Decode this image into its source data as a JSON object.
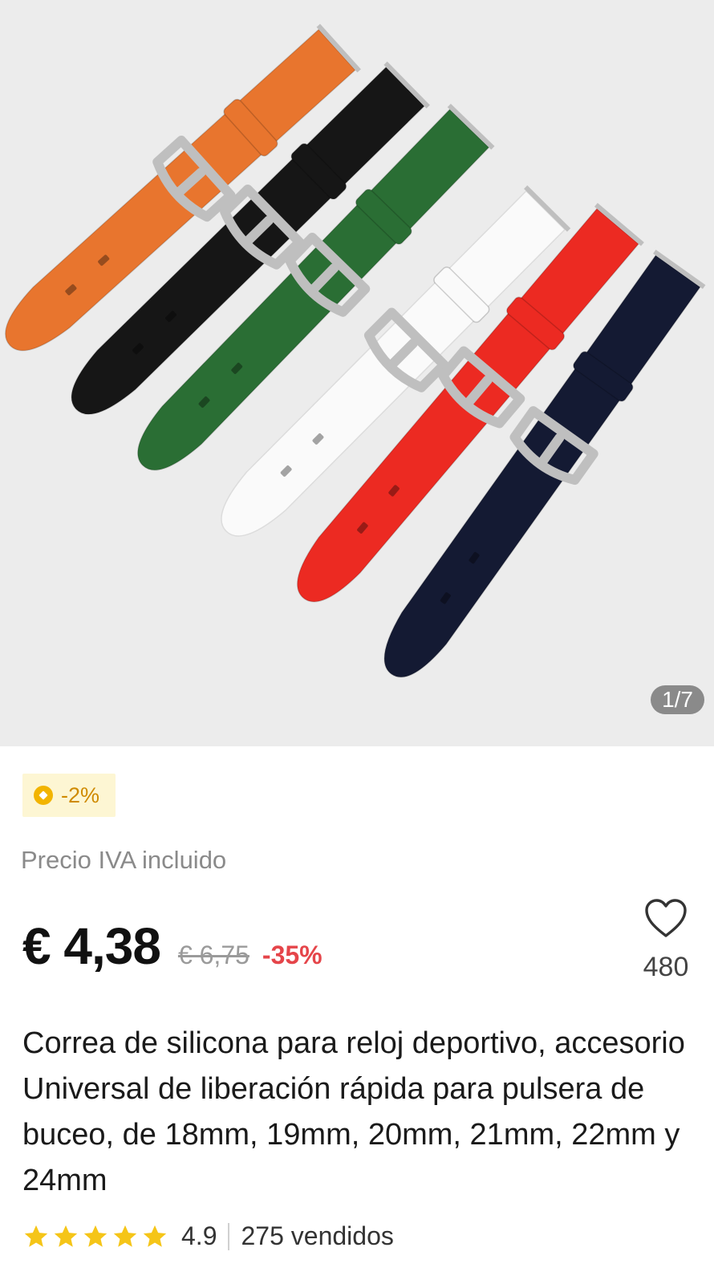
{
  "gallery": {
    "counter": "1/7",
    "strap_colors": [
      "#e8752e",
      "#161616",
      "#2a6e34",
      "#fafafa",
      "#ec2a22",
      "#141a33"
    ],
    "buckle_color": "#bfbfbf",
    "background": "#ececec"
  },
  "promo": {
    "icon": "coin-icon",
    "label": "-2%"
  },
  "price": {
    "vat_note": "Precio IVA incluido",
    "current": "€ 4,38",
    "original": "€ 6,75",
    "discount": "-35%",
    "discount_color": "#e5454a"
  },
  "wishlist": {
    "icon": "heart-icon",
    "count": "480"
  },
  "product": {
    "title": "Correa de silicona para reloj deportivo, accesorio Universal de liberación rápida para pulsera de buceo, de 18mm, 19mm, 20mm, 21mm, 22mm y 24mm"
  },
  "rating": {
    "stars": 5,
    "star_color": "#f5c518",
    "value": "4.9",
    "sold": "275 vendidos"
  }
}
